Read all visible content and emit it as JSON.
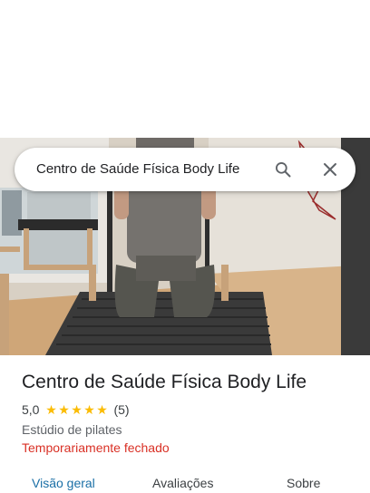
{
  "search": {
    "query": "Centro de Saúde Física Body Life"
  },
  "place": {
    "name": "Centro de Saúde Física Body Life",
    "rating": "5,0",
    "stars": 5,
    "review_count": "(5)",
    "category": "Estúdio de pilates",
    "status": "Temporariamente fechado"
  },
  "tabs": [
    {
      "label": "Visão geral",
      "active": true
    },
    {
      "label": "Avaliações",
      "active": false
    },
    {
      "label": "Sobre",
      "active": false
    }
  ],
  "icons": {
    "search": "search-icon",
    "close": "close-icon",
    "star": "star-icon"
  },
  "colors": {
    "star": "#fbbc04",
    "status_closed": "#d93025",
    "active_tab": "#1a6fa6"
  }
}
